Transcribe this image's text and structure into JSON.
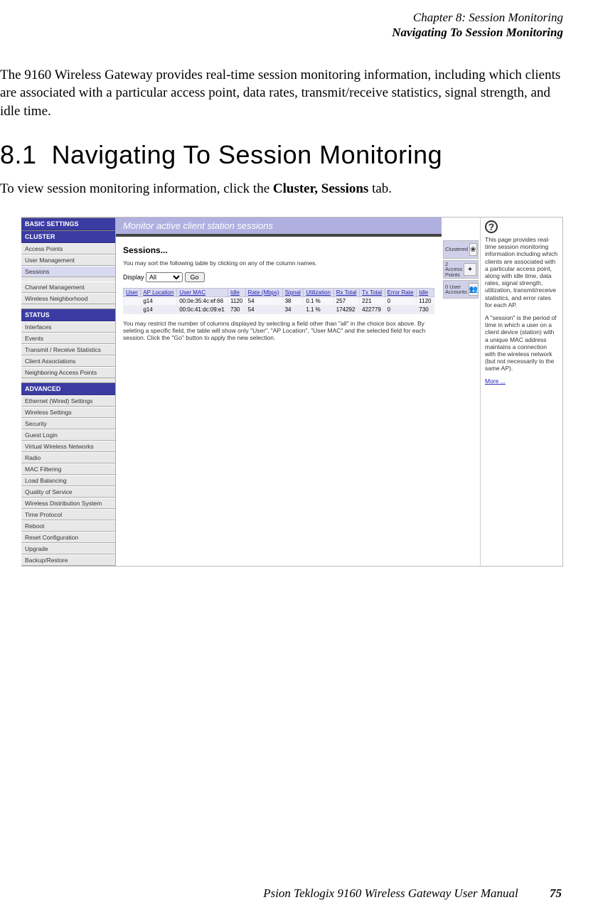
{
  "header": {
    "chapter": "Chapter 8:  Session Monitoring",
    "title": "Navigating To Session Monitoring"
  },
  "intro": "The 9160 Wireless Gateway provides real-time session monitoring information, including which clients are associated with a particular access point, data rates, transmit/receive statistics, signal strength, and idle time.",
  "section": {
    "number": "8.1",
    "heading": "Navigating To Session Monitoring"
  },
  "instruction_pre": "To view session monitoring information, click the ",
  "instruction_bold": "Cluster, Sessions",
  "instruction_post": " tab.",
  "nav": {
    "basic": "BASIC SETTINGS",
    "cluster": "CLUSTER",
    "cluster_items": [
      "Access Points",
      "User Management",
      "Sessions"
    ],
    "cluster_items2": [
      "Channel Management",
      "Wireless Neighborhood"
    ],
    "status": "STATUS",
    "status_items": [
      "Interfaces",
      "Events",
      "Transmit / Receive Statistics",
      "Client Associations",
      "Neighboring Access Points"
    ],
    "advanced": "ADVANCED",
    "adv_items": [
      "Ethernet (Wired) Settings",
      "Wireless Settings",
      "Security",
      "Guest Login",
      "Virtual Wireless Networks",
      "Radio",
      "MAC Filtering",
      "Load Balancing",
      "Quality of Service",
      "Wireless Distribution System",
      "Time Protocol",
      "Reboot",
      "Reset Configuration",
      "Upgrade",
      "Backup/Restore"
    ]
  },
  "title_bar": "Monitor active client station sessions",
  "sessions_title": "Sessions...",
  "sort_note": "You may sort the following table by clicking on any of the column names.",
  "display_label": "Display",
  "display_value": "All",
  "go_label": "Go",
  "cols": [
    "User",
    "AP Location",
    "User MAC",
    "Idle",
    "Rate (Mbps)",
    "Signal",
    "Utilization",
    "Rx Total",
    "Tx Total",
    "Error Rate",
    "Idle"
  ],
  "rows": [
    {
      "user": "",
      "ap": "g14",
      "mac": "00:0e:35:4c:ef:66",
      "idle": "1120",
      "rate": "54",
      "signal": "38",
      "util": "0.1 %",
      "rx": "257",
      "tx": "221",
      "err": "0",
      "idle2": "1120"
    },
    {
      "user": "",
      "ap": "g14",
      "mac": "00:0c:41:dc:09:e1",
      "idle": "730",
      "rate": "54",
      "signal": "34",
      "util": "1.1 %",
      "rx": "174292",
      "tx": "422779",
      "err": "0",
      "idle2": "730"
    }
  ],
  "restrict_note": "You may restrict the number of columns displayed by selecting a field other than \"all\" in the choice box above.  By seleting a specific field, the table will show only \"User\", \"AP Location\", \"User MAC\" and the selected field for each session.  Click the \"Go\" button to apply the new selection.",
  "badge1": {
    "txt": "Clustered"
  },
  "badge2": {
    "txt1": "2",
    "txt2": "Access",
    "txt3": "Points"
  },
  "badge3": {
    "txt1": "0 User",
    "txt2": "Accounts"
  },
  "help": {
    "p1": "This page provides real-time session monitoring information including which clients are associated with a particular access point, along with idle time, data rates, signal strength, utilization, transmit/receive statistics, and error rates for each AP.",
    "p2": "A \"session\" is the period of time in which a user on a client device (station) with a unique MAC address maintains a connection with the wireless network (but not necessarily to the same AP).",
    "more": "More ..."
  },
  "footer": {
    "text": "Psion Teklogix 9160 Wireless Gateway User Manual",
    "page": "75"
  }
}
